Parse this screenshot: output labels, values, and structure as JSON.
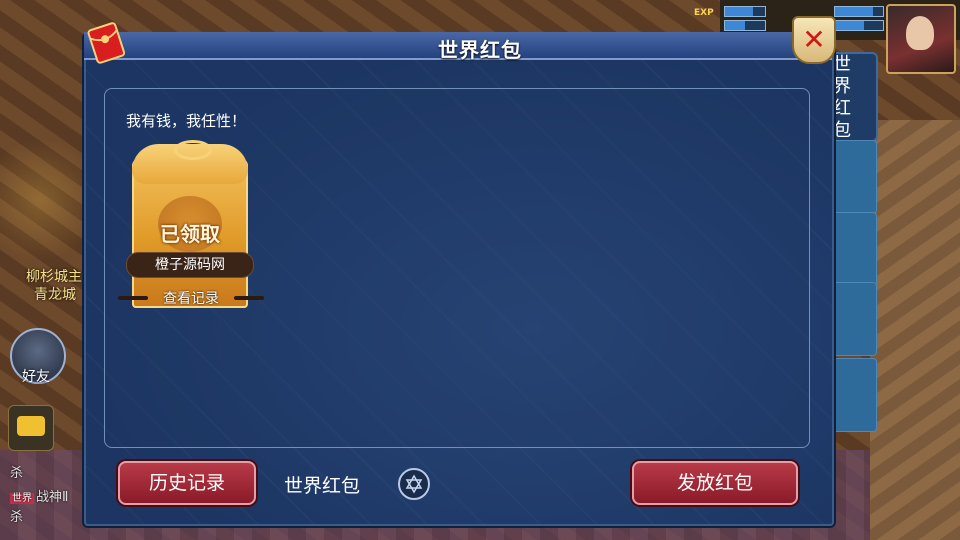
{
  "dialog": {
    "title": "世界红包",
    "slogan": "我有钱，我任性！"
  },
  "packet": {
    "status": "已领取",
    "sender": "橙子源码网",
    "view_record": "查看记录"
  },
  "footer": {
    "history_button": "历史记录",
    "channel_label": "世界红包",
    "send_button": "发放红包"
  },
  "side_tabs": {
    "active_label": "世界红包"
  },
  "background": {
    "exp_label": "EXP",
    "friend_label": "好友",
    "left_label_1": "柳杉城主",
    "left_label_2": "青龙城",
    "chat_lines": [
      {
        "tag": "",
        "text": "杀"
      },
      {
        "tag": "世界",
        "text": "战神Ⅱ"
      },
      {
        "tag": "",
        "text": "杀"
      }
    ]
  },
  "colors": {
    "dialog_bg": "#1c3562",
    "title_bar": "#24427e",
    "button_red": "#8a1a28",
    "packet_gold": "#e09a28"
  },
  "icons": {
    "close": "close-icon",
    "packet": "red-packet-icon",
    "settings": "settings-gear-icon"
  }
}
